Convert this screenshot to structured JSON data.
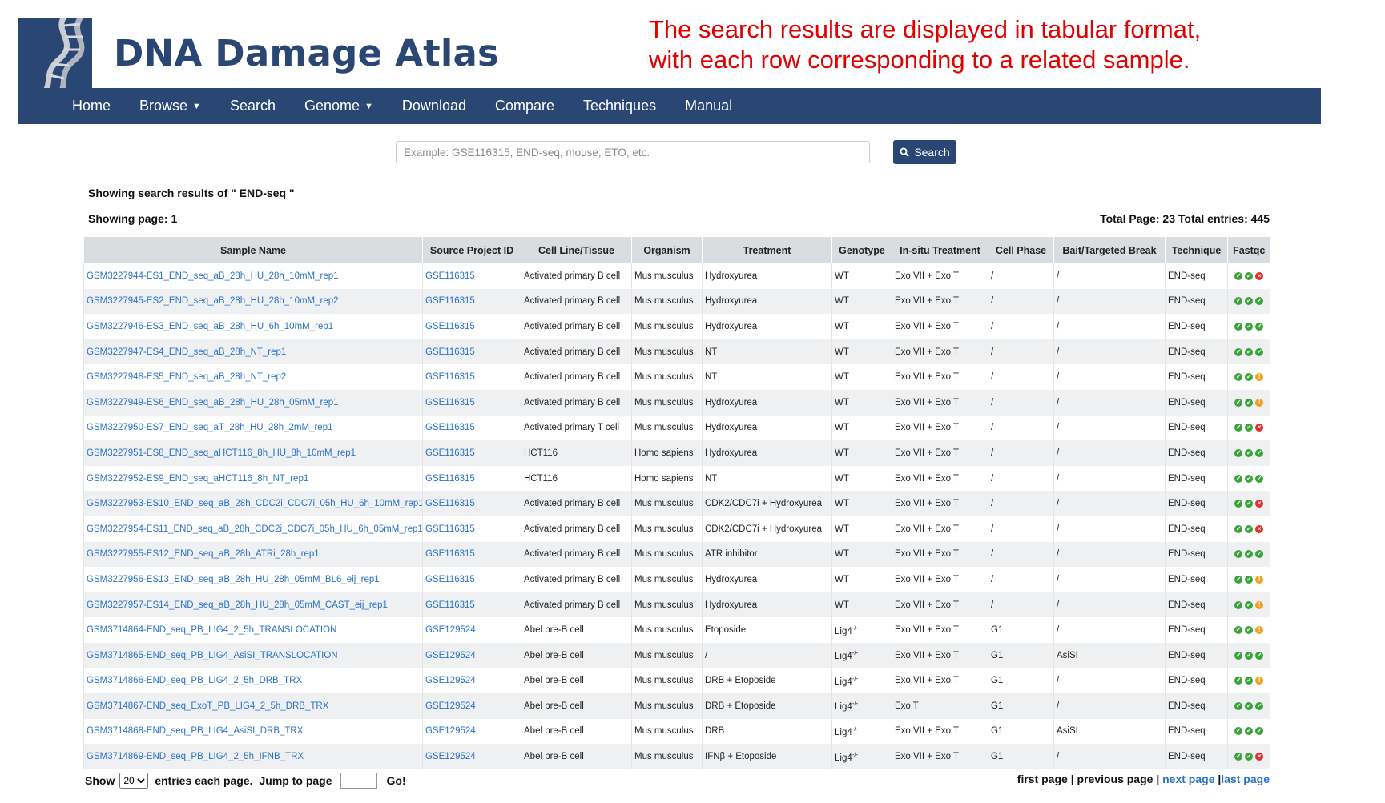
{
  "app": {
    "title": "DNA Damage Atlas",
    "annotation_line1": "The search results are displayed in tabular format,",
    "annotation_line2": "with each row corresponding to a related sample."
  },
  "nav": {
    "items": [
      "Home",
      "Browse",
      "Search",
      "Genome",
      "Download",
      "Compare",
      "Techniques",
      "Manual"
    ]
  },
  "search": {
    "placeholder": "Example: GSE116315, END-seq, mouse, ETO, etc.",
    "value": "",
    "button_label": "Search"
  },
  "results": {
    "query_text": "Showing search results of \" END-seq \"",
    "page_text": "Showing page: 1",
    "totals_text": "Total Page: 23 Total entries: 445"
  },
  "table": {
    "headers": [
      "Sample Name",
      "Source Project ID",
      "Cell Line/Tissue",
      "Organism",
      "Treatment",
      "Genotype",
      "In-situ Treatment",
      "Cell Phase",
      "Bait/Targeted Break",
      "Technique",
      "Fastqc"
    ],
    "rows": [
      {
        "sample": "GSM3227944-ES1_END_seq_aB_28h_HU_28h_10mM_rep1",
        "project": "GSE116315",
        "cell": "Activated primary B cell",
        "organism": "Mus musculus",
        "treatment": "Hydroxyurea",
        "genotype": "WT",
        "insitu": "Exo VII + Exo T",
        "phase": "/",
        "bait": "/",
        "technique": "END-seq",
        "fastqc": [
          "pass",
          "pass",
          "fail"
        ]
      },
      {
        "sample": "GSM3227945-ES2_END_seq_aB_28h_HU_28h_10mM_rep2",
        "project": "GSE116315",
        "cell": "Activated primary B cell",
        "organism": "Mus musculus",
        "treatment": "Hydroxyurea",
        "genotype": "WT",
        "insitu": "Exo VII + Exo T",
        "phase": "/",
        "bait": "/",
        "technique": "END-seq",
        "fastqc": [
          "pass",
          "pass",
          "pass"
        ]
      },
      {
        "sample": "GSM3227946-ES3_END_seq_aB_28h_HU_6h_10mM_rep1",
        "project": "GSE116315",
        "cell": "Activated primary B cell",
        "organism": "Mus musculus",
        "treatment": "Hydroxyurea",
        "genotype": "WT",
        "insitu": "Exo VII + Exo T",
        "phase": "/",
        "bait": "/",
        "technique": "END-seq",
        "fastqc": [
          "pass",
          "pass",
          "pass"
        ]
      },
      {
        "sample": "GSM3227947-ES4_END_seq_aB_28h_NT_rep1",
        "project": "GSE116315",
        "cell": "Activated primary B cell",
        "organism": "Mus musculus",
        "treatment": "NT",
        "genotype": "WT",
        "insitu": "Exo VII + Exo T",
        "phase": "/",
        "bait": "/",
        "technique": "END-seq",
        "fastqc": [
          "pass",
          "pass",
          "pass"
        ]
      },
      {
        "sample": "GSM3227948-ES5_END_seq_aB_28h_NT_rep2",
        "project": "GSE116315",
        "cell": "Activated primary B cell",
        "organism": "Mus musculus",
        "treatment": "NT",
        "genotype": "WT",
        "insitu": "Exo VII + Exo T",
        "phase": "/",
        "bait": "/",
        "technique": "END-seq",
        "fastqc": [
          "pass",
          "pass",
          "warn"
        ]
      },
      {
        "sample": "GSM3227949-ES6_END_seq_aB_28h_HU_28h_05mM_rep1",
        "project": "GSE116315",
        "cell": "Activated primary B cell",
        "organism": "Mus musculus",
        "treatment": "Hydroxyurea",
        "genotype": "WT",
        "insitu": "Exo VII + Exo T",
        "phase": "/",
        "bait": "/",
        "technique": "END-seq",
        "fastqc": [
          "pass",
          "pass",
          "warn"
        ]
      },
      {
        "sample": "GSM3227950-ES7_END_seq_aT_28h_HU_28h_2mM_rep1",
        "project": "GSE116315",
        "cell": "Activated primary T cell",
        "organism": "Mus musculus",
        "treatment": "Hydroxyurea",
        "genotype": "WT",
        "insitu": "Exo VII + Exo T",
        "phase": "/",
        "bait": "/",
        "technique": "END-seq",
        "fastqc": [
          "pass",
          "pass",
          "fail"
        ]
      },
      {
        "sample": "GSM3227951-ES8_END_seq_aHCT116_8h_HU_8h_10mM_rep1",
        "project": "GSE116315",
        "cell": "HCT116",
        "organism": "Homo sapiens",
        "treatment": "Hydroxyurea",
        "genotype": "WT",
        "insitu": "Exo VII + Exo T",
        "phase": "/",
        "bait": "/",
        "technique": "END-seq",
        "fastqc": [
          "pass",
          "pass",
          "pass"
        ]
      },
      {
        "sample": "GSM3227952-ES9_END_seq_aHCT116_8h_NT_rep1",
        "project": "GSE116315",
        "cell": "HCT116",
        "organism": "Homo sapiens",
        "treatment": "NT",
        "genotype": "WT",
        "insitu": "Exo VII + Exo T",
        "phase": "/",
        "bait": "/",
        "technique": "END-seq",
        "fastqc": [
          "pass",
          "pass",
          "pass"
        ]
      },
      {
        "sample": "GSM3227953-ES10_END_seq_aB_28h_CDC2i_CDC7i_05h_HU_6h_10mM_rep1",
        "project": "GSE116315",
        "cell": "Activated primary B cell",
        "organism": "Mus musculus",
        "treatment": "CDK2/CDC7i + Hydroxyurea",
        "genotype": "WT",
        "insitu": "Exo VII + Exo T",
        "phase": "/",
        "bait": "/",
        "technique": "END-seq",
        "fastqc": [
          "pass",
          "pass",
          "fail"
        ]
      },
      {
        "sample": "GSM3227954-ES11_END_seq_aB_28h_CDC2i_CDC7i_05h_HU_6h_05mM_rep1",
        "project": "GSE116315",
        "cell": "Activated primary B cell",
        "organism": "Mus musculus",
        "treatment": "CDK2/CDC7i + Hydroxyurea",
        "genotype": "WT",
        "insitu": "Exo VII + Exo T",
        "phase": "/",
        "bait": "/",
        "technique": "END-seq",
        "fastqc": [
          "pass",
          "pass",
          "fail"
        ]
      },
      {
        "sample": "GSM3227955-ES12_END_seq_aB_28h_ATRi_28h_rep1",
        "project": "GSE116315",
        "cell": "Activated primary B cell",
        "organism": "Mus musculus",
        "treatment": "ATR inhibitor",
        "genotype": "WT",
        "insitu": "Exo VII + Exo T",
        "phase": "/",
        "bait": "/",
        "technique": "END-seq",
        "fastqc": [
          "pass",
          "pass",
          "pass"
        ]
      },
      {
        "sample": "GSM3227956-ES13_END_seq_aB_28h_HU_28h_05mM_BL6_eij_rep1",
        "project": "GSE116315",
        "cell": "Activated primary B cell",
        "organism": "Mus musculus",
        "treatment": "Hydroxyurea",
        "genotype": "WT",
        "insitu": "Exo VII + Exo T",
        "phase": "/",
        "bait": "/",
        "technique": "END-seq",
        "fastqc": [
          "pass",
          "pass",
          "warn"
        ]
      },
      {
        "sample": "GSM3227957-ES14_END_seq_aB_28h_HU_28h_05mM_CAST_eij_rep1",
        "project": "GSE116315",
        "cell": "Activated primary B cell",
        "organism": "Mus musculus",
        "treatment": "Hydroxyurea",
        "genotype": "WT",
        "insitu": "Exo VII + Exo T",
        "phase": "/",
        "bait": "/",
        "technique": "END-seq",
        "fastqc": [
          "pass",
          "pass",
          "warn"
        ]
      },
      {
        "sample": "GSM3714864-END_seq_PB_LIG4_2_5h_TRANSLOCATION",
        "project": "GSE129524",
        "cell": "Abel pre-B cell",
        "organism": "Mus musculus",
        "treatment": "Etoposide",
        "genotype": "Lig4",
        "insitu": "Exo VII + Exo T",
        "phase": "G1",
        "bait": "/",
        "technique": "END-seq",
        "fastqc": [
          "pass",
          "pass",
          "warn"
        ]
      },
      {
        "sample": "GSM3714865-END_seq_PB_LIG4_AsiSI_TRANSLOCATION",
        "project": "GSE129524",
        "cell": "Abel pre-B cell",
        "organism": "Mus musculus",
        "treatment": "/",
        "genotype": "Lig4",
        "insitu": "Exo VII + Exo T",
        "phase": "G1",
        "bait": "AsiSI",
        "technique": "END-seq",
        "fastqc": [
          "pass",
          "pass",
          "pass"
        ]
      },
      {
        "sample": "GSM3714866-END_seq_PB_LIG4_2_5h_DRB_TRX",
        "project": "GSE129524",
        "cell": "Abel pre-B cell",
        "organism": "Mus musculus",
        "treatment": "DRB + Etoposide",
        "genotype": "Lig4",
        "insitu": "Exo VII + Exo T",
        "phase": "G1",
        "bait": "/",
        "technique": "END-seq",
        "fastqc": [
          "pass",
          "pass",
          "warn"
        ]
      },
      {
        "sample": "GSM3714867-END_seq_ExoT_PB_LIG4_2_5h_DRB_TRX",
        "project": "GSE129524",
        "cell": "Abel pre-B cell",
        "organism": "Mus musculus",
        "treatment": "DRB + Etoposide",
        "genotype": "Lig4",
        "insitu": "Exo T",
        "phase": "G1",
        "bait": "/",
        "technique": "END-seq",
        "fastqc": [
          "pass",
          "pass",
          "pass"
        ]
      },
      {
        "sample": "GSM3714868-END_seq_PB_LIG4_AsiSI_DRB_TRX",
        "project": "GSE129524",
        "cell": "Abel pre-B cell",
        "organism": "Mus musculus",
        "treatment": "DRB",
        "genotype": "Lig4",
        "insitu": "Exo VII + Exo T",
        "phase": "G1",
        "bait": "AsiSI",
        "technique": "END-seq",
        "fastqc": [
          "pass",
          "pass",
          "pass"
        ]
      },
      {
        "sample": "GSM3714869-END_seq_PB_LIG4_2_5h_IFNB_TRX",
        "project": "GSE129524",
        "cell": "Abel pre-B cell",
        "organism": "Mus musculus",
        "treatment": "IFNβ + Etoposide",
        "genotype": "Lig4",
        "insitu": "Exo VII + Exo T",
        "phase": "G1",
        "bait": "/",
        "technique": "END-seq",
        "fastqc": [
          "pass",
          "pass",
          "fail"
        ]
      }
    ],
    "genotype_superscript": "-/-"
  },
  "footer": {
    "show_label": "Show",
    "page_size": "20",
    "page_size_options": [
      "20"
    ],
    "entries_label": "entries each page.",
    "jump_label": "Jump to page",
    "jump_value": "",
    "go_label": "Go!",
    "first_page": "first page",
    "previous_page": "previous page",
    "next_page": "next page",
    "last_page": "last page",
    "separator": "|"
  },
  "icons": {
    "logo": "dna-helix-icon",
    "search": "search-icon",
    "caret": "caret-down-icon",
    "fastqc_pass": "check-circle-icon",
    "fastqc_warn": "exclamation-circle-icon",
    "fastqc_fail": "x-circle-icon"
  },
  "colors": {
    "brand": "#2a4673",
    "link": "#2a72c9",
    "annotation": "#e00000",
    "pass": "#3aa33a",
    "warn": "#f0a020",
    "fail": "#e03030",
    "header_bg": "#d9dde0",
    "row_alt": "#eef0f2"
  }
}
